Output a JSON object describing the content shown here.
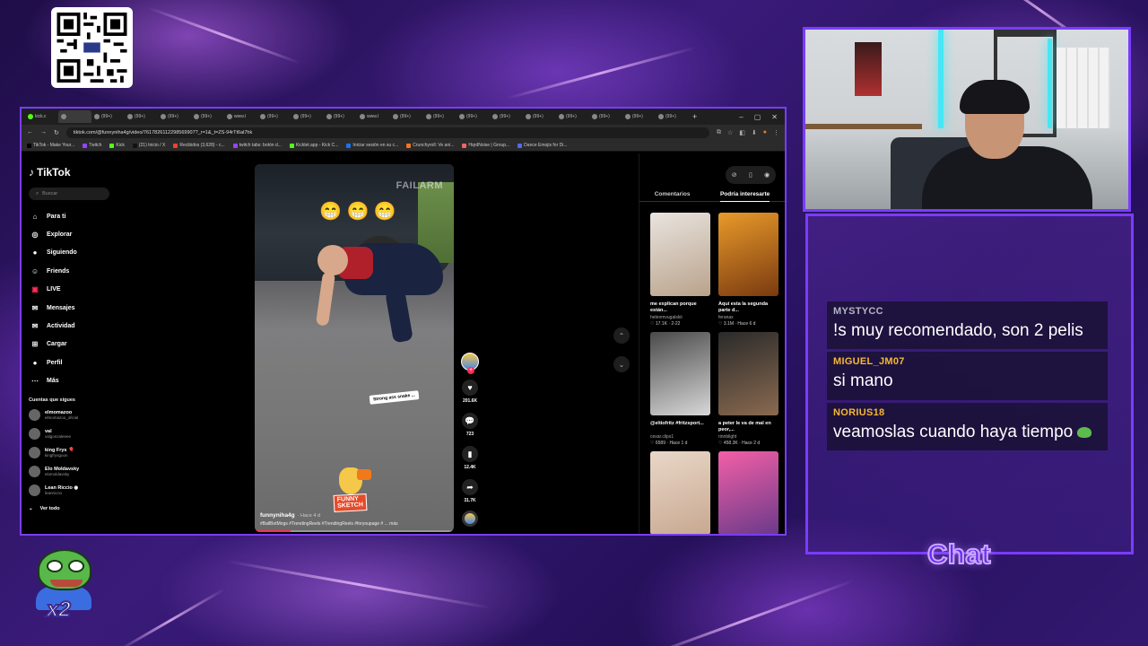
{
  "colors": {
    "accent": "#7a3cff",
    "tiktok_red": "#fe2c55",
    "chat_user_gray": "#b5b5c3",
    "chat_user_orange": "#f7b733"
  },
  "browser": {
    "tabs": [
      "kick.c",
      "",
      "(99+)",
      "(99+)",
      "(99+)",
      "(99+)",
      "www.l",
      "(99+)",
      "(99+)",
      "(99+)",
      "www.l",
      "(99+)",
      "(99+)",
      "(99+)",
      "(99+)",
      "(99+)",
      "(99+)",
      "(99+)",
      "(99+)",
      "(99+)"
    ],
    "new_tab": "+",
    "url": "tiktok.com/@funnyniha4g/video/7617826112298569907?_r=1&_t=ZS-94rTt6al7hk",
    "bookmarks": [
      "TikTok - Make Your...",
      "Twitch",
      "Kick",
      "(21) Inicio / X",
      "Recibidos (3,628) - c...",
      "twitch tabs: botón d...",
      "Kicklet.app - Kick C...",
      "Iniciar sesión en su c...",
      "Crunchyroll: Ve ani...",
      "HqrdNoise | Group...",
      "Dance Emojis for Di..."
    ]
  },
  "tiktok": {
    "logo": "TikTok",
    "search_placeholder": "Buscar",
    "nav": [
      {
        "label": "Para ti",
        "icon": "home-icon",
        "glyph": "⌂"
      },
      {
        "label": "Explorar",
        "icon": "compass-icon",
        "glyph": "◎"
      },
      {
        "label": "Siguiendo",
        "icon": "following-icon",
        "glyph": "●"
      },
      {
        "label": "Friends",
        "icon": "friends-icon",
        "glyph": "☺"
      },
      {
        "label": "LIVE",
        "icon": "live-icon",
        "glyph": "▣"
      },
      {
        "label": "Mensajes",
        "icon": "messages-icon",
        "glyph": "✉"
      },
      {
        "label": "Actividad",
        "icon": "activity-icon",
        "glyph": "✉"
      },
      {
        "label": "Cargar",
        "icon": "upload-icon",
        "glyph": "⊞"
      },
      {
        "label": "Perfil",
        "icon": "profile-icon",
        "glyph": "●"
      },
      {
        "label": "Más",
        "icon": "more-icon",
        "glyph": "⋯"
      }
    ],
    "following_title": "Cuentas que sigues",
    "following": [
      {
        "name": "elmomazoo",
        "handle": "elmomazoo_oficial"
      },
      {
        "name": "val",
        "handle": "valgonzaleeee"
      },
      {
        "name": "king Frys 🎈",
        "handle": "kingfrysgoon"
      },
      {
        "name": "Elo Moldavsky",
        "handle": "elomoldavsky"
      },
      {
        "name": "Lean Riccio ◉",
        "handle": "leanriccio"
      }
    ],
    "see_all": "Ver todo",
    "video": {
      "overlay_emoji": "😁 😁 😁",
      "watermark": "FAILARM",
      "caption": "Strong ass snake ...",
      "sticker_line1": "FUNNY",
      "sticker_line2": "SKETCH",
      "author": "funnyniha4g",
      "time": "· Hace 4 d",
      "tags": "#BallBotMogs #TrendingReels #TrendingReels #foryoupage # ... más",
      "progress": 0.18
    },
    "actions": {
      "likes": "201.6K",
      "comments": "723",
      "saves": "12.4K",
      "shares": "31.7K"
    },
    "tabs": [
      "Comentarios",
      "Podría interesarte"
    ],
    "recommended": [
      {
        "title": "me explican porque están...",
        "user": "helenmvugalskii",
        "stats": "♡ 17.1K · 2-22",
        "c1": "#e9e4df",
        "c2": "#b9a28b"
      },
      {
        "title": "Aquí esta la segunda parte d...",
        "user": "feranax",
        "stats": "♡ 3.1M · Hace 6 d",
        "c1": "#e89a2a",
        "c2": "#7a3a10"
      },
      {
        "title": "@eltiofritz #fritzsport...",
        "user": "cesar.clips1",
        "stats": "♡ 6589 · Hace 1 d",
        "c1": "#4a4a4a",
        "c2": "#d8d8d8"
      },
      {
        "title": "a peter le va de mal en peor,...",
        "user": "rinnblight",
        "stats": "♡ 458.3K · Hace 2 d",
        "c1": "#2a2a2a",
        "c2": "#8a6a50"
      },
      {
        "title": "",
        "user": "",
        "stats": "",
        "c1": "#e9d7c8",
        "c2": "#c8a890"
      },
      {
        "title": "",
        "user": "",
        "stats": "",
        "c1": "#f25fa6",
        "c2": "#6a3a8a"
      }
    ]
  },
  "chat": {
    "label": "Chat",
    "messages": [
      {
        "user": "MYSTYCC",
        "text": "!s muy recomendado, son 2 pelis",
        "color": "#b5b5c3"
      },
      {
        "user": "MIGUEL_JM07",
        "text": "si mano",
        "color": "#f7b733"
      },
      {
        "user": "NORIUS18",
        "text": "veamoslas cuando haya tiempo",
        "color": "#f7b733",
        "emote": "pepe-emote"
      }
    ]
  },
  "overlay": {
    "pepe_multiplier": "x2"
  }
}
